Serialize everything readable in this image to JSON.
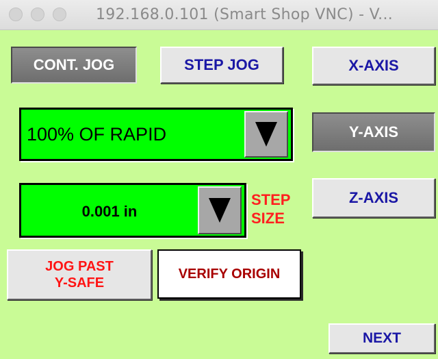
{
  "window": {
    "title": "192.168.0.101 (Smart Shop VNC) - V..."
  },
  "jog_mode": {
    "continuous_label": "CONT. JOG",
    "step_label": "STEP JOG",
    "selected": "CONT. JOG"
  },
  "axes": {
    "x_label": "X-AXIS",
    "y_label": "Y-AXIS",
    "z_label": "Z-AXIS",
    "selected": "Y-AXIS"
  },
  "feed_rate": {
    "value": "100% OF RAPID"
  },
  "step_size": {
    "value": "0.001 in",
    "label_line1": "STEP",
    "label_line2": "SIZE"
  },
  "actions": {
    "jog_past_line1": "JOG PAST",
    "jog_past_line2": "Y-SAFE",
    "verify_origin": "VERIFY ORIGIN",
    "next": "NEXT"
  },
  "colors": {
    "background": "#c9fb96",
    "combo_fill": "#00ff00",
    "button_text_blue": "#1a17a5",
    "warning_red": "#ff1f1f"
  },
  "icons": {
    "combo_arrow": "triangle-down-icon"
  }
}
